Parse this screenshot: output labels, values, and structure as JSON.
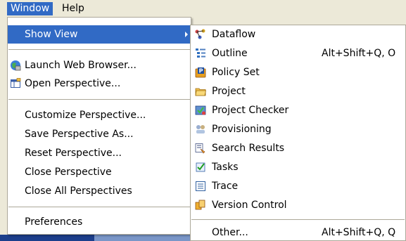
{
  "menubar": {
    "items": [
      {
        "label": "Window",
        "active": true
      },
      {
        "label": "Help",
        "active": false
      }
    ]
  },
  "window_menu": {
    "items": [
      {
        "label": "Show View",
        "highlighted": true,
        "has_submenu": true
      },
      {
        "label": "Launch Web Browser...",
        "icon": "web-browser-icon"
      },
      {
        "label": "Open Perspective...",
        "icon": "open-perspective-icon"
      },
      {
        "label": "Customize Perspective..."
      },
      {
        "label": "Save Perspective As..."
      },
      {
        "label": "Reset Perspective..."
      },
      {
        "label": "Close Perspective"
      },
      {
        "label": "Close All Perspectives"
      },
      {
        "label": "Preferences"
      }
    ]
  },
  "show_view_menu": {
    "items": [
      {
        "label": "Dataflow",
        "icon": "dataflow-icon",
        "shortcut": ""
      },
      {
        "label": "Outline",
        "icon": "outline-icon",
        "shortcut": "Alt+Shift+Q, O"
      },
      {
        "label": "Policy Set",
        "icon": "policy-set-icon",
        "shortcut": ""
      },
      {
        "label": "Project",
        "icon": "project-folder-icon",
        "shortcut": ""
      },
      {
        "label": "Project Checker",
        "icon": "project-checker-icon",
        "shortcut": ""
      },
      {
        "label": "Provisioning",
        "icon": "provisioning-icon",
        "shortcut": ""
      },
      {
        "label": "Search Results",
        "icon": "search-results-icon",
        "shortcut": ""
      },
      {
        "label": "Tasks",
        "icon": "tasks-icon",
        "shortcut": ""
      },
      {
        "label": "Trace",
        "icon": "trace-icon",
        "shortcut": ""
      },
      {
        "label": "Version Control",
        "icon": "version-control-icon",
        "shortcut": ""
      },
      {
        "label": "Other...",
        "icon": "",
        "shortcut": "Alt+Shift+Q, Q"
      }
    ]
  },
  "colors": {
    "highlight": "#316ac5",
    "menu_bg": "#ffffff",
    "menubar_bg": "#ece9d8",
    "separator": "#aca899"
  }
}
